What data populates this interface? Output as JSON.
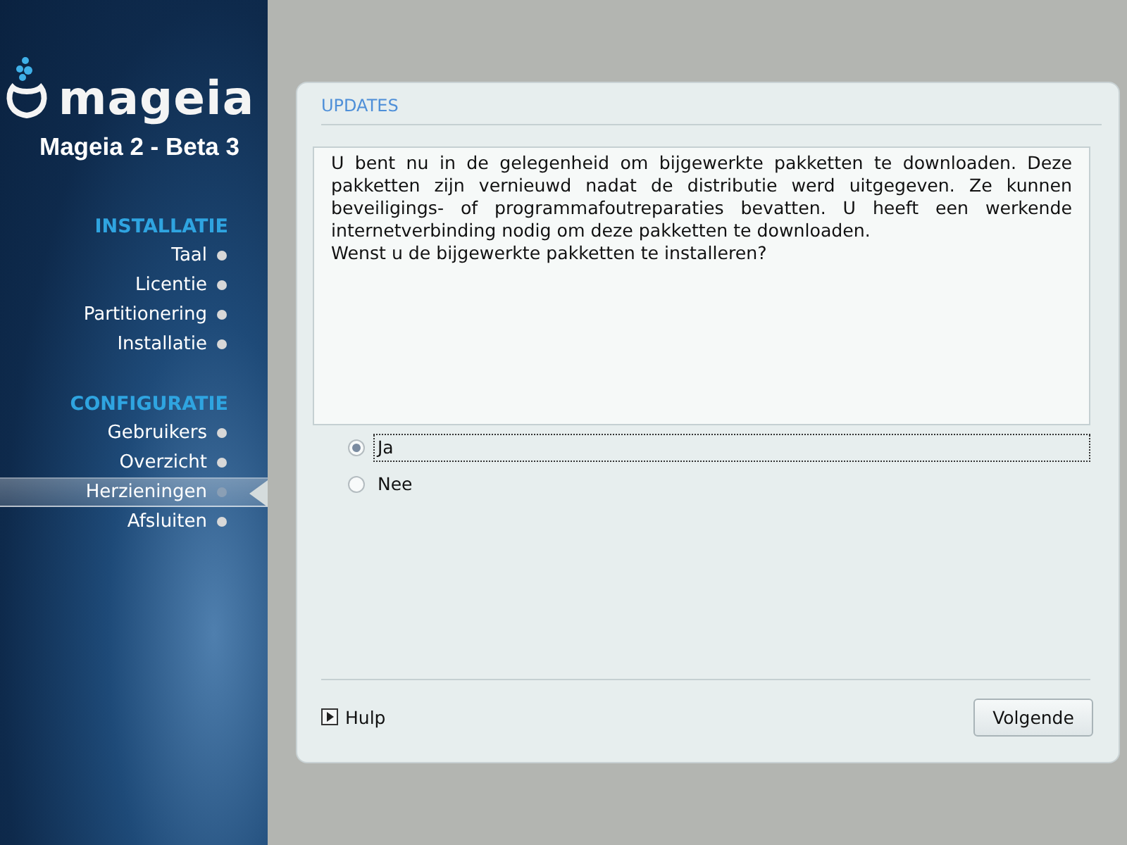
{
  "sidebar": {
    "logo_text": "mageia",
    "version": "Mageia 2 - Beta 3",
    "sections": [
      {
        "title": "INSTALLATIE",
        "items": [
          {
            "label": "Taal",
            "selected": false
          },
          {
            "label": "Licentie",
            "selected": false
          },
          {
            "label": "Partitionering",
            "selected": false
          },
          {
            "label": "Installatie",
            "selected": false
          }
        ]
      },
      {
        "title": "CONFIGURATIE",
        "items": [
          {
            "label": "Gebruikers",
            "selected": false
          },
          {
            "label": "Overzicht",
            "selected": false
          },
          {
            "label": "Herzieningen",
            "selected": true
          },
          {
            "label": "Afsluiten",
            "selected": false
          }
        ]
      }
    ]
  },
  "panel": {
    "title": "UPDATES",
    "message": [
      "U bent nu in de gelegenheid om bijgewerkte pakketten te downloaden. Deze pakketten zijn vernieuwd nadat de distributie werd uitgegeven. Ze kunnen beveiligings- of programmafoutreparaties bevatten. U heeft een werkende internetverbinding nodig om deze pakketten te downloaden.",
      "Wenst u de bijgewerkte pakketten te installeren?"
    ],
    "options": [
      {
        "label": "Ja",
        "selected": true
      },
      {
        "label": "Nee",
        "selected": false
      }
    ],
    "help": "Hulp",
    "next": "Volgende"
  }
}
